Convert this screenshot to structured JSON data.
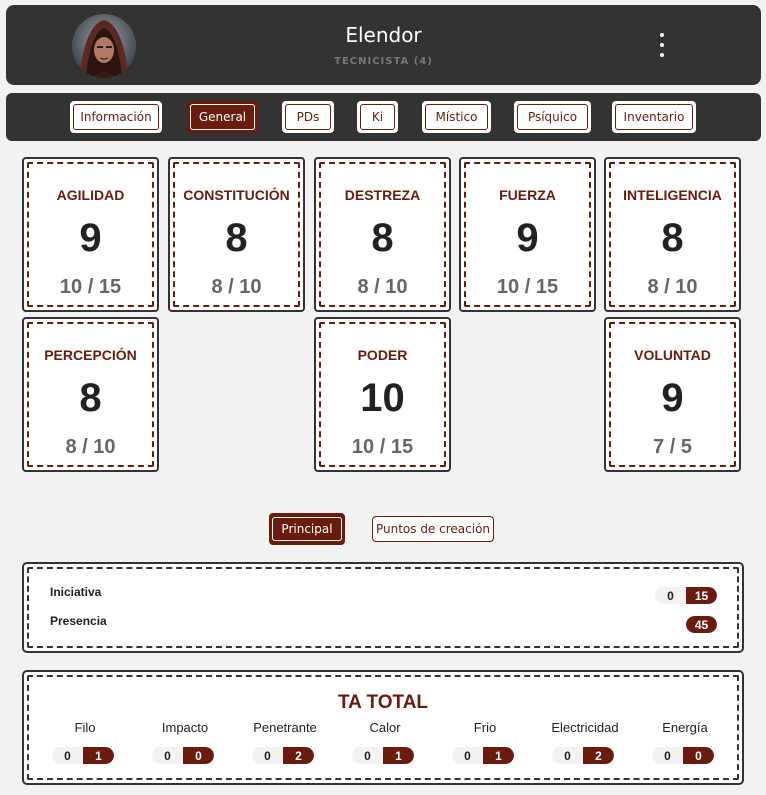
{
  "header": {
    "name": "Elendor",
    "class_label": "TECNICISTA (4)"
  },
  "tabs": [
    {
      "label": "Información",
      "active": false
    },
    {
      "label": "General",
      "active": true
    },
    {
      "label": "PDs",
      "active": false
    },
    {
      "label": "Ki",
      "active": false
    },
    {
      "label": "Místico",
      "active": false
    },
    {
      "label": "Psíquico",
      "active": false
    },
    {
      "label": "Inventario",
      "active": false
    }
  ],
  "attributes": [
    {
      "label": "AGILIDAD",
      "value": "9",
      "ratio": "10 / 15"
    },
    {
      "label": "CONSTITUCIÓN",
      "value": "8",
      "ratio": "8 / 10"
    },
    {
      "label": "DESTREZA",
      "value": "8",
      "ratio": "8 / 10"
    },
    {
      "label": "FUERZA",
      "value": "9",
      "ratio": "10 / 15"
    },
    {
      "label": "INTELIGENCIA",
      "value": "8",
      "ratio": "8 / 10"
    },
    {
      "label": "PERCEPCIÓN",
      "value": "8",
      "ratio": "8 / 10"
    },
    {
      "label": "PODER",
      "value": "10",
      "ratio": "10 / 15"
    },
    {
      "label": "VOLUNTAD",
      "value": "9",
      "ratio": "7 / 5"
    }
  ],
  "subtabs": [
    {
      "label": "Principal",
      "active": true
    },
    {
      "label": "Puntos de creación",
      "active": false
    }
  ],
  "principal": {
    "iniciativa": {
      "label": "Iniciativa",
      "base": "0",
      "total": "15"
    },
    "presencia": {
      "label": "Presencia",
      "total": "45"
    }
  },
  "ta_total": {
    "title": "TA TOTAL",
    "columns": [
      {
        "label": "Filo",
        "base": "0",
        "total": "1"
      },
      {
        "label": "Impacto",
        "base": "0",
        "total": "0"
      },
      {
        "label": "Penetrante",
        "base": "0",
        "total": "2"
      },
      {
        "label": "Calor",
        "base": "0",
        "total": "1"
      },
      {
        "label": "Frio",
        "base": "0",
        "total": "1"
      },
      {
        "label": "Electricidad",
        "base": "0",
        "total": "2"
      },
      {
        "label": "Energía",
        "base": "0",
        "total": "0"
      }
    ]
  },
  "colors": {
    "accent": "#6b1b0c",
    "dark": "#333333",
    "background": "#f2f2f2"
  },
  "icons": {
    "avatar": "hooded-character-portrait",
    "menu": "kebab-menu-icon"
  }
}
